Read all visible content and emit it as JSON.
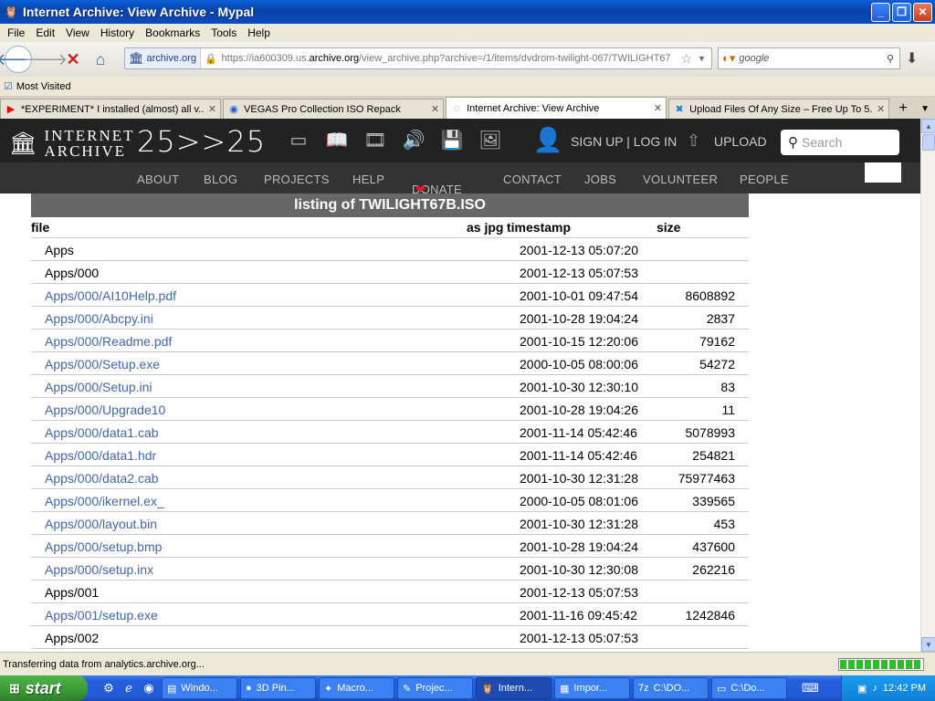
{
  "window": {
    "title": "Internet Archive: View Archive - Mypal"
  },
  "menu": [
    "File",
    "Edit",
    "View",
    "History",
    "Bookmarks",
    "Tools",
    "Help"
  ],
  "urlbar": {
    "site": "archive.org",
    "url_prefix": "https://ia600309.us.",
    "url_domain": "archive.org",
    "url_rest": "/view_archive.php?archive=/1/items/dvdrom-twilight-067/TWILIGHT67",
    "search_placeholder": "google"
  },
  "bookmarks": {
    "most_visited": "Most Visited"
  },
  "tabs": [
    {
      "label": "*EXPERIMENT* I installed (almost) all v...",
      "icon": "youtube-icon",
      "active": false
    },
    {
      "label": "VEGAS Pro Collection ISO Repack",
      "icon": "vegas-icon",
      "active": false
    },
    {
      "label": "Internet Archive: View Archive",
      "icon": "loading-icon",
      "active": true
    },
    {
      "label": "Upload Files Of Any Size – Free Up To 5...",
      "icon": "upload-site-icon",
      "active": false
    }
  ],
  "ia_header": {
    "logo_line1": "INTERNET",
    "logo_line2": "ARCHIVE",
    "anniversary": "25>>25",
    "signup": "SIGN UP | LOG IN",
    "upload": "UPLOAD",
    "search_placeholder": "Search"
  },
  "ia_nav": [
    "ABOUT",
    "BLOG",
    "PROJECTS",
    "HELP",
    "DONATE",
    "CONTACT",
    "JOBS",
    "VOLUNTEER",
    "PEOPLE"
  ],
  "listing": {
    "title": "listing of TWILIGHT67B.ISO",
    "columns": {
      "file": "file",
      "as_jpg": "as jpg",
      "timestamp": "timestamp",
      "size": "size"
    },
    "rows": [
      {
        "file": "Apps",
        "timestamp": "2001-12-13 05:07:20",
        "size": "",
        "link": false
      },
      {
        "file": "Apps/000",
        "timestamp": "2001-12-13 05:07:53",
        "size": "",
        "link": false
      },
      {
        "file": "Apps/000/AI10Help.pdf",
        "timestamp": "2001-10-01 09:47:54",
        "size": "8608892",
        "link": true
      },
      {
        "file": "Apps/000/Abcpy.ini",
        "timestamp": "2001-10-28 19:04:24",
        "size": "2837",
        "link": true
      },
      {
        "file": "Apps/000/Readme.pdf",
        "timestamp": "2001-10-15 12:20:06",
        "size": "79162",
        "link": true
      },
      {
        "file": "Apps/000/Setup.exe",
        "timestamp": "2000-10-05 08:00:06",
        "size": "54272",
        "link": true
      },
      {
        "file": "Apps/000/Setup.ini",
        "timestamp": "2001-10-30 12:30:10",
        "size": "83",
        "link": true
      },
      {
        "file": "Apps/000/Upgrade10",
        "timestamp": "2001-10-28 19:04:26",
        "size": "11",
        "link": true
      },
      {
        "file": "Apps/000/data1.cab",
        "timestamp": "2001-11-14 05:42:46",
        "size": "5078993",
        "link": true
      },
      {
        "file": "Apps/000/data1.hdr",
        "timestamp": "2001-11-14 05:42:46",
        "size": "254821",
        "link": true
      },
      {
        "file": "Apps/000/data2.cab",
        "timestamp": "2001-10-30 12:31:28",
        "size": "75977463",
        "link": true
      },
      {
        "file": "Apps/000/ikernel.ex_",
        "timestamp": "2000-10-05 08:01:06",
        "size": "339565",
        "link": true
      },
      {
        "file": "Apps/000/layout.bin",
        "timestamp": "2001-10-30 12:31:28",
        "size": "453",
        "link": true
      },
      {
        "file": "Apps/000/setup.bmp",
        "timestamp": "2001-10-28 19:04:24",
        "size": "437600",
        "link": true
      },
      {
        "file": "Apps/000/setup.inx",
        "timestamp": "2001-10-30 12:30:08",
        "size": "262216",
        "link": true
      },
      {
        "file": "Apps/001",
        "timestamp": "2001-12-13 05:07:53",
        "size": "",
        "link": false
      },
      {
        "file": "Apps/001/setup.exe",
        "timestamp": "2001-11-16 09:45:42",
        "size": "1242846",
        "link": true
      },
      {
        "file": "Apps/002",
        "timestamp": "2001-12-13 05:07:53",
        "size": "",
        "link": false
      }
    ]
  },
  "status": {
    "text": "Transferring data from analytics.archive.org..."
  },
  "taskbar": {
    "start": "start",
    "tasks": [
      {
        "label": "Windo...",
        "icon": "window-icon",
        "active": false
      },
      {
        "label": "3D Pin...",
        "icon": "pinball-icon",
        "active": false
      },
      {
        "label": "Macro...",
        "icon": "macro-icon",
        "active": false
      },
      {
        "label": "Projec...",
        "icon": "project-icon",
        "active": false
      },
      {
        "label": "Intern...",
        "icon": "browser-icon",
        "active": true
      },
      {
        "label": "Impor...",
        "icon": "import-icon",
        "active": false
      },
      {
        "label": "C:\\DO...",
        "icon": "7zip-icon",
        "active": false
      },
      {
        "label": "C:\\Do...",
        "icon": "folder-icon",
        "active": false
      }
    ],
    "clock": "12:42 PM"
  }
}
